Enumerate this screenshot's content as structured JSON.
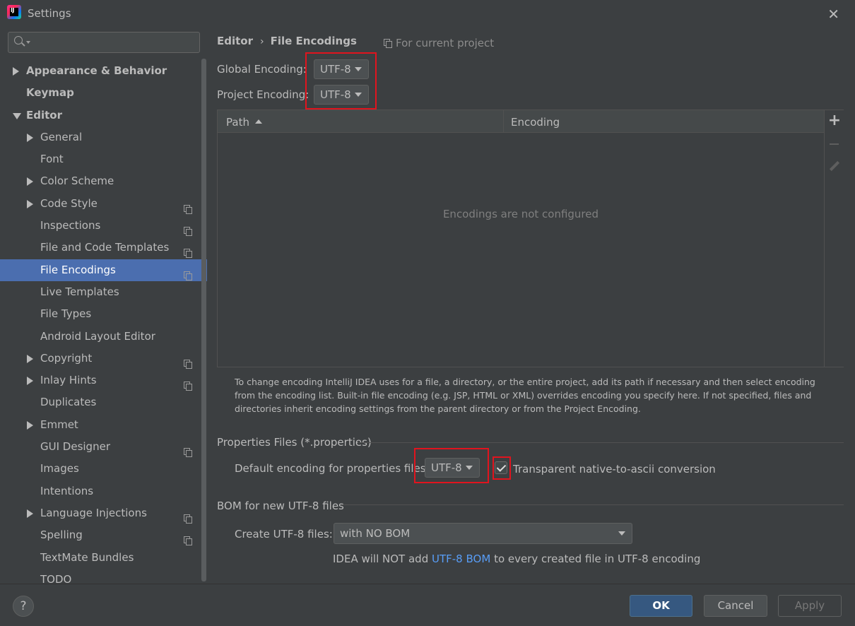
{
  "window": {
    "title": "Settings",
    "icon_label": "IJ",
    "close_icon": "close-icon"
  },
  "sidebar": {
    "search_placeholder": "",
    "items": [
      {
        "label": "Appearance & Behavior",
        "level": 0,
        "bold": true,
        "arrow": "right",
        "project": false
      },
      {
        "label": "Keymap",
        "level": 0,
        "bold": true,
        "arrow": "",
        "project": false
      },
      {
        "label": "Editor",
        "level": 0,
        "bold": true,
        "arrow": "down",
        "project": false
      },
      {
        "label": "General",
        "level": 1,
        "arrow": "right",
        "project": false
      },
      {
        "label": "Font",
        "level": 1,
        "arrow": "",
        "project": false
      },
      {
        "label": "Color Scheme",
        "level": 1,
        "arrow": "right",
        "project": false
      },
      {
        "label": "Code Style",
        "level": 1,
        "arrow": "right",
        "project": true
      },
      {
        "label": "Inspections",
        "level": 1,
        "arrow": "",
        "project": true
      },
      {
        "label": "File and Code Templates",
        "level": 1,
        "arrow": "",
        "project": true
      },
      {
        "label": "File Encodings",
        "level": 1,
        "arrow": "",
        "project": true,
        "selected": true
      },
      {
        "label": "Live Templates",
        "level": 1,
        "arrow": "",
        "project": false
      },
      {
        "label": "File Types",
        "level": 1,
        "arrow": "",
        "project": false
      },
      {
        "label": "Android Layout Editor",
        "level": 1,
        "arrow": "",
        "project": false
      },
      {
        "label": "Copyright",
        "level": 1,
        "arrow": "right",
        "project": true
      },
      {
        "label": "Inlay Hints",
        "level": 1,
        "arrow": "right",
        "project": true
      },
      {
        "label": "Duplicates",
        "level": 1,
        "arrow": "",
        "project": false
      },
      {
        "label": "Emmet",
        "level": 1,
        "arrow": "right",
        "project": false
      },
      {
        "label": "GUI Designer",
        "level": 1,
        "arrow": "",
        "project": true
      },
      {
        "label": "Images",
        "level": 1,
        "arrow": "",
        "project": false
      },
      {
        "label": "Intentions",
        "level": 1,
        "arrow": "",
        "project": false
      },
      {
        "label": "Language Injections",
        "level": 1,
        "arrow": "right",
        "project": true
      },
      {
        "label": "Spelling",
        "level": 1,
        "arrow": "",
        "project": true
      },
      {
        "label": "TextMate Bundles",
        "level": 1,
        "arrow": "",
        "project": false
      },
      {
        "label": "TODO",
        "level": 1,
        "arrow": "",
        "project": false
      }
    ]
  },
  "main": {
    "breadcrumb": [
      "Editor",
      "File Encodings"
    ],
    "for_current_project": "For current project",
    "global_encoding_label": "Global Encoding:",
    "global_encoding_value": "UTF-8",
    "project_encoding_label": "Project Encoding:",
    "project_encoding_value": "UTF-8",
    "table": {
      "columns": [
        "Path",
        "Encoding"
      ],
      "empty_text": "Encodings are not configured"
    },
    "info_text": "To change encoding IntelliJ IDEA uses for a file, a directory, or the entire project, add its path if necessary and then select encoding from the encoding list. Built-in file encoding (e.g. JSP, HTML or XML) overrides encoding you specify here. If not specified, files and directories inherit encoding settings from the parent directory or from the Project Encoding.",
    "properties": {
      "section_title": "Properties Files (*.properties)",
      "default_label": "Default encoding for properties files:",
      "default_value": "UTF-8",
      "native_ascii_label": "Transparent native-to-ascii conversion",
      "native_ascii_checked": true
    },
    "bom": {
      "section_title": "BOM for new UTF-8 files",
      "create_label": "Create UTF-8 files:",
      "create_value": "with NO BOM",
      "note_prefix": "IDEA will NOT add",
      "note_link": "UTF-8 BOM",
      "note_suffix": "to every created file in UTF-8 encoding"
    }
  },
  "footer": {
    "help_label": "?",
    "ok_label": "OK",
    "cancel_label": "Cancel",
    "apply_label": "Apply"
  },
  "colors": {
    "background": "#3c3f41",
    "selection": "#4b6eaf",
    "highlight_box": "#e1141e",
    "link": "#589df6",
    "ok_button": "#365880"
  }
}
